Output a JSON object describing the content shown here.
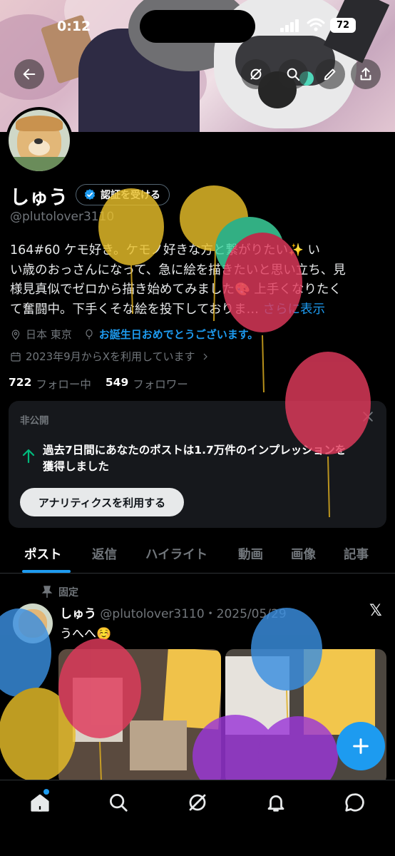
{
  "status": {
    "time": "0:12",
    "battery": "72"
  },
  "profile": {
    "name": "しゅう",
    "verify_label": "認証を受ける",
    "handle": "@plutolover3110",
    "bio_line1": "164#60 ケモ好き。ケモノ好きな方と繋がりたい✨ い",
    "bio_line2": "い歳のおっさんになって、急に絵を描きたいと思い立ち、見",
    "bio_line3": "様見真似でゼロから描き始めてみました🎨 上手くなりたく",
    "bio_line4a": "て奮闘中。下手くそな絵を投下しておりま…",
    "bio_more": "さらに表示",
    "location": "日本 東京",
    "birthday": "お誕生日おめでとうございます。",
    "joined": "2023年9月からXを利用しています",
    "following_count": "722",
    "following_label": "フォロー中",
    "followers_count": "549",
    "followers_label": "フォロワー"
  },
  "private_card": {
    "label": "非公開",
    "message_line1": "過去7日間にあなたのポストは1.7万件のインプレッションを",
    "message_line2": "獲得しました",
    "button": "アナリティクスを利用する"
  },
  "tabs": [
    "ポスト",
    "返信",
    "ハイライト",
    "動画",
    "画像",
    "記事"
  ],
  "post": {
    "pinned_label": "固定",
    "author": "しゅう",
    "handle_date": "@plutolover3110・2025/05/29",
    "text": "うへへ☺️"
  },
  "nav": [
    "home-icon",
    "search-icon",
    "grok-icon",
    "notifications-icon",
    "messages-icon"
  ],
  "colors": {
    "accent": "#1d9bf0",
    "background": "#000000",
    "card": "#16181c"
  }
}
